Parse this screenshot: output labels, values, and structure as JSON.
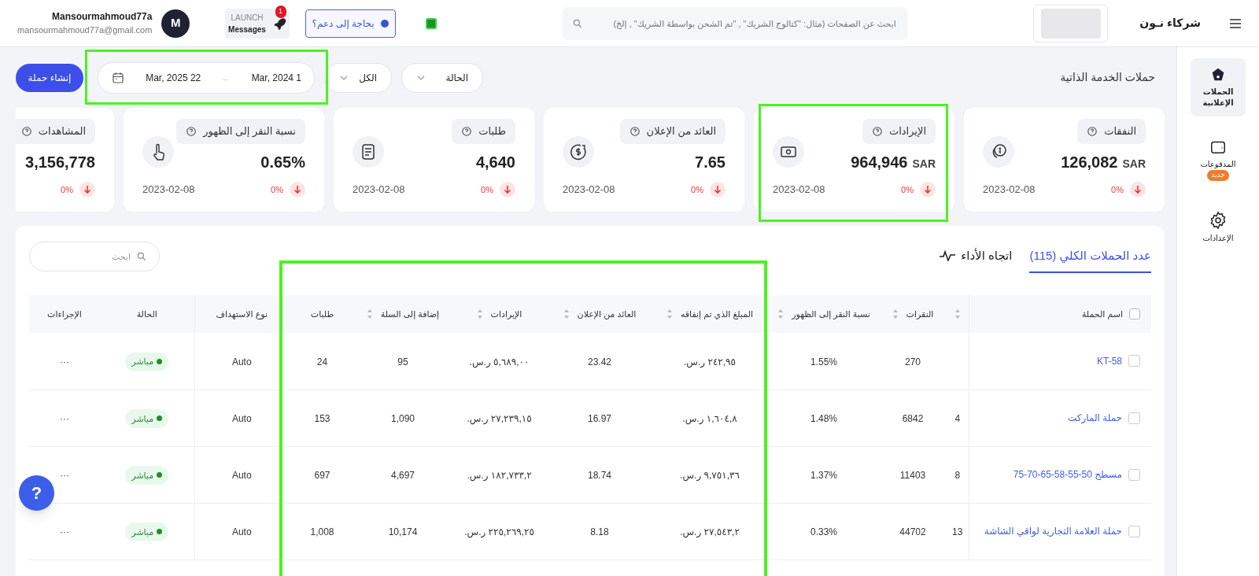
{
  "header": {
    "user_name": "Mansourmahmoud77a",
    "user_email": "mansourmahmoud77a@gmail.com",
    "avatar_letter": "M",
    "launch": {
      "line1": "LAUNCH",
      "line2": "Messages",
      "badge": "1"
    },
    "support": "بحاجة إلى دعم؟",
    "search": {
      "placeholder": "ابحث عن الصفحات (مثال: \"كتالوج الشريك\" , \"تم الشحن بواسطة الشريك\" , إلخ)"
    },
    "logo": "شركاء نـون"
  },
  "sidebar": {
    "items": [
      {
        "label": "الحملات الإعلانية",
        "selected": true
      },
      {
        "label": "المدفوعات",
        "selected": false,
        "badge": "جديد"
      },
      {
        "label": "الإعدادات",
        "selected": false
      }
    ]
  },
  "filters": {
    "title": "حملات الخدمة الذاتية",
    "status": "الحالة",
    "all": "الكل",
    "date_from": "Mar, 2024 1",
    "date_separator": "←",
    "date_to": "Mar, 2025 22",
    "create_button": "إنشاء حملة"
  },
  "kpis": [
    {
      "label": "النفقات",
      "value": "126,082",
      "unit": "SAR",
      "change": "0%",
      "date": "2023-02-08"
    },
    {
      "label": "الإيرادات",
      "value": "964,946",
      "unit": "SAR",
      "change": "0%",
      "date": "2023-02-08"
    },
    {
      "label": "العائد من الإعلان",
      "value": "7.65",
      "change": "0%",
      "date": "2023-02-08"
    },
    {
      "label": "طلبات",
      "value": "4,640",
      "change": "0%",
      "date": "2023-02-08"
    },
    {
      "label": "نسبة النقر إلى الظهور",
      "value": "0.65%",
      "change": "0%",
      "date": "2023-02-08"
    },
    {
      "label": "المشاهدات",
      "value": "3,156,778",
      "change": "0%"
    }
  ],
  "tabs": [
    {
      "label": "عدد الحملات الكلي (115)",
      "selected": true
    },
    {
      "label": "اتجاه الأداء",
      "selected": false
    }
  ],
  "table_search": {
    "placeholder": "ابحث"
  },
  "table": {
    "all_checked": false,
    "columns": [
      {
        "label": "اسم الحملة",
        "sortable": false
      },
      {
        "sortable": true
      },
      {
        "label": "النقرات",
        "sortable": true
      },
      {
        "label": "نسبة النقر إلى الظهور",
        "sortable": true
      },
      {
        "label": "المبلغ الذي تم إنفاقه",
        "sortable": true
      },
      {
        "label": "العائد من الإعلان",
        "sortable": true
      },
      {
        "label": "الإيرادات",
        "sortable": true
      },
      {
        "label": "إضافة إلى السلة",
        "sortable": true
      },
      {
        "label": "طلبات",
        "sortable": false
      },
      {
        "label": "نوع الاستهداف",
        "sortable": false
      },
      {
        "label": "الحالة",
        "sortable": false
      },
      {
        "label": "الإجراءات",
        "sortable": false
      }
    ],
    "rows": [
      {
        "checked": false,
        "cells": [
          "KT-58",
          "",
          "270",
          "1.55%",
          "٢٤٢,٩٥ ر.س.",
          "23.42",
          "٥,٦٨٩,٠٠ ر.س.",
          "95",
          "24",
          "Auto",
          "مباشر",
          "···"
        ]
      },
      {
        "checked": false,
        "cells": [
          "حملة الماركت",
          "4",
          "6842",
          "1.48%",
          "١,٦٠٤,٨ ر.س.",
          "16.97",
          "٢٧,٢٣٩,١٥ ر.س.",
          "1,090",
          "153",
          "Auto",
          "مباشر",
          "···"
        ]
      },
      {
        "checked": false,
        "cells": [
          "مسطح 50-55-58-65-70-75",
          "8",
          "11403",
          "1.37%",
          "٩,٧٥١,٣٦ ر.س.",
          "18.74",
          "١٨٢,٧٣٣,٢ ر.س.",
          "4,697",
          "697",
          "Auto",
          "مباشر",
          "···"
        ]
      },
      {
        "checked": false,
        "cells": [
          "حملة العلامة التجارية لواقي الشاشة",
          "13",
          "44702",
          "0.33%",
          "٢٧,٥٤٣,٢ ر.س.",
          "8.18",
          "٢٢٥,٢٦٩,٢٥ ر.س.",
          "10,174",
          "1,008",
          "Auto",
          "مباشر",
          "···"
        ]
      }
    ]
  },
  "help_button": "?"
}
